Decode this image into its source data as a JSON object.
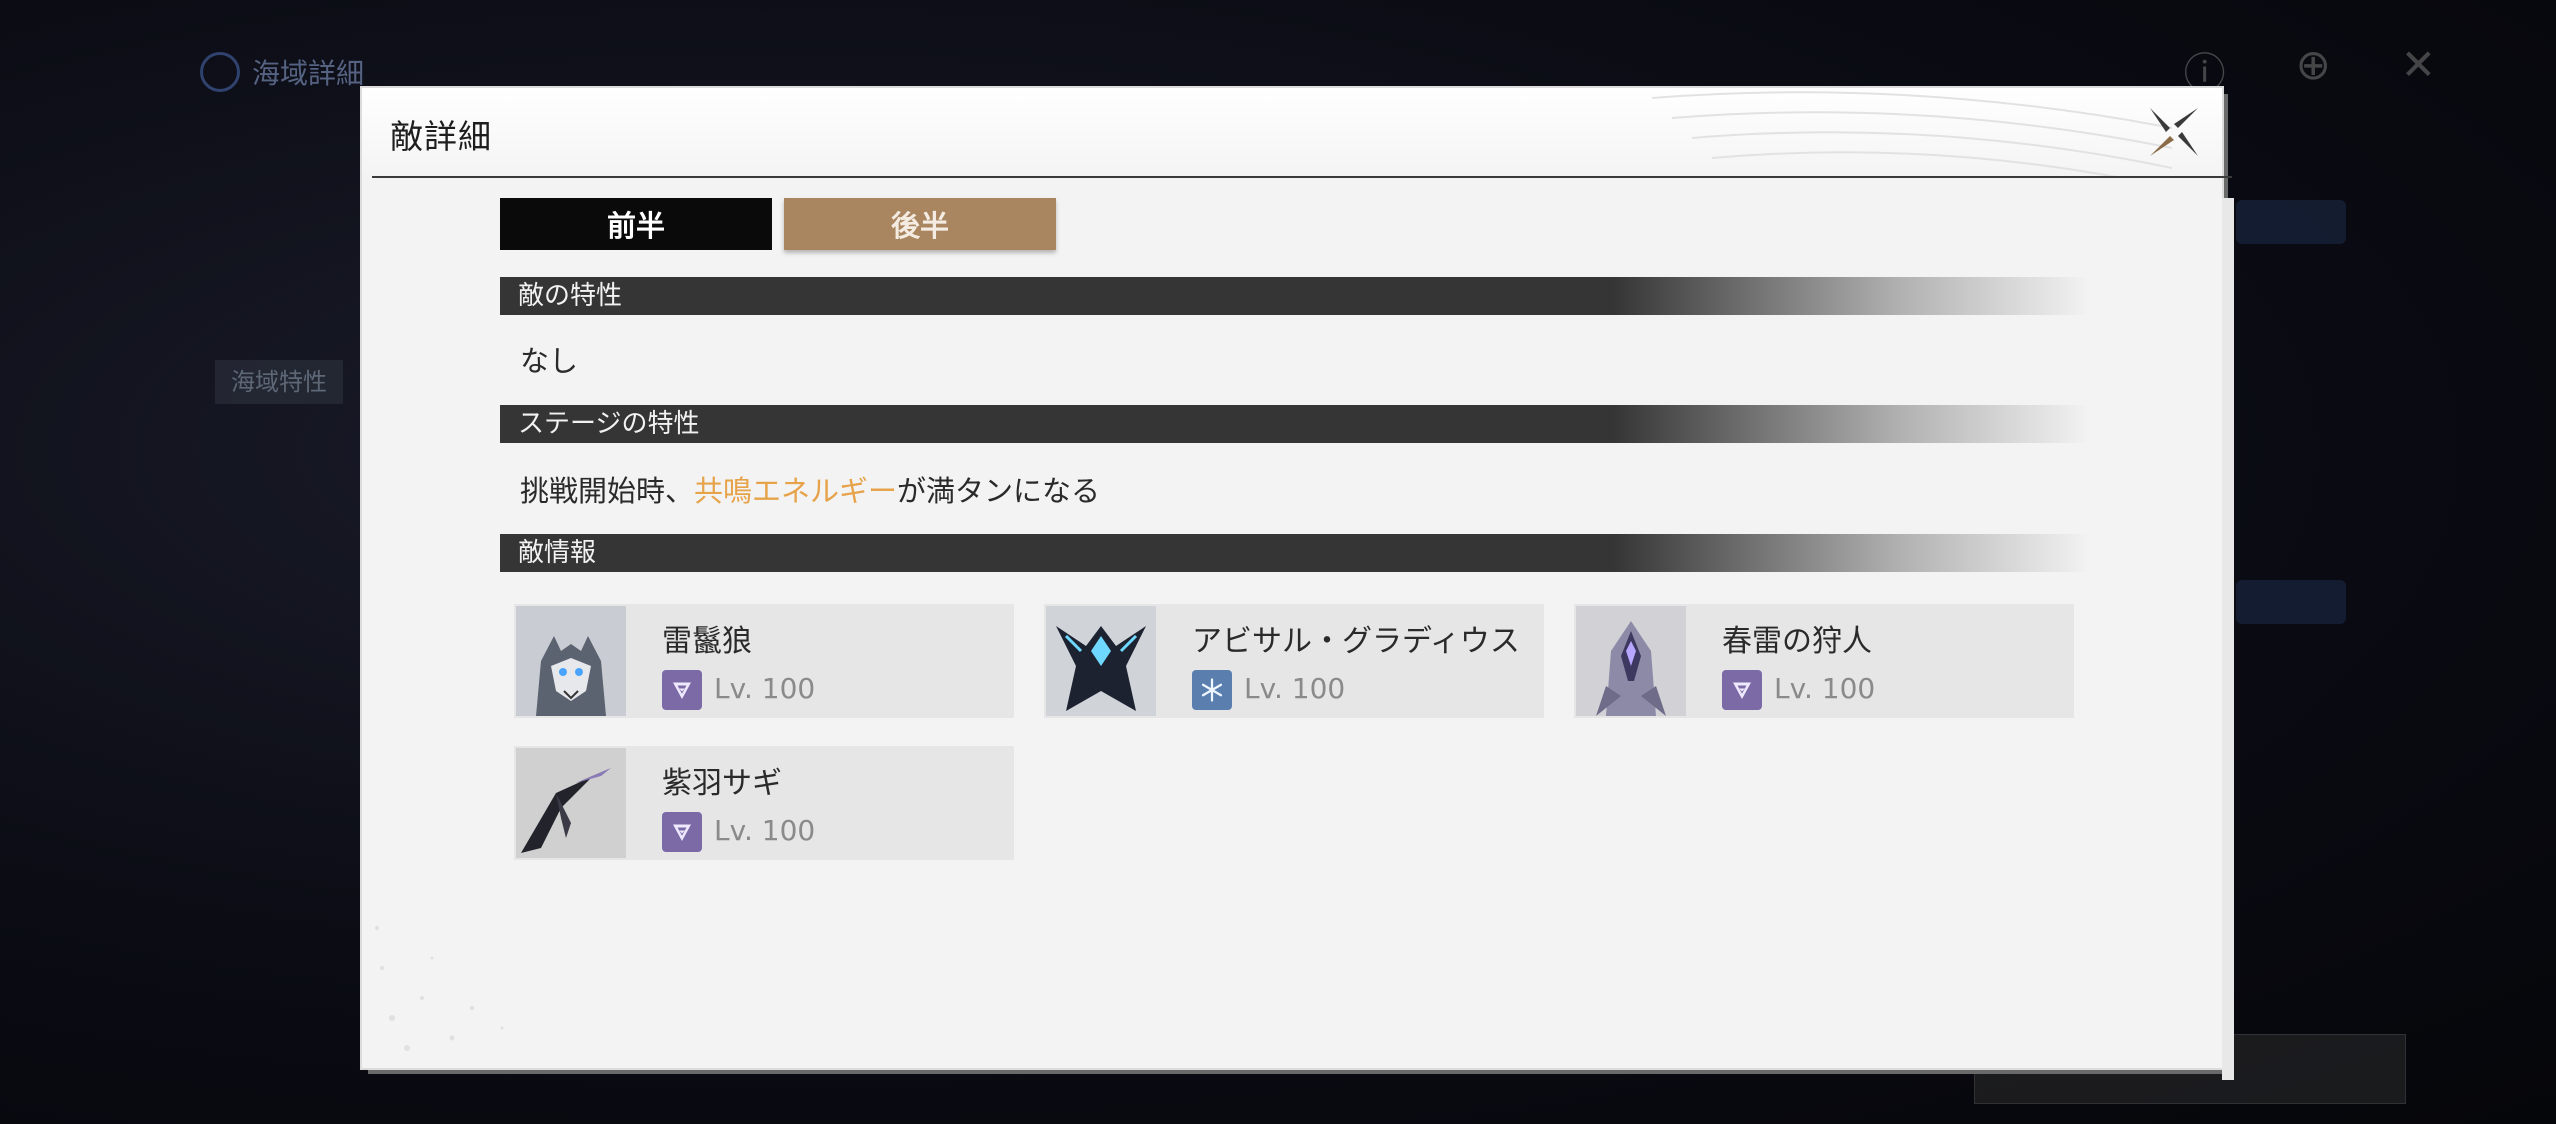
{
  "background": {
    "title": "海域詳細",
    "left_tag": "海域特性"
  },
  "modal": {
    "title": "敵詳細",
    "tabs": [
      {
        "label": "前半",
        "active": true
      },
      {
        "label": "後半",
        "active": false
      }
    ],
    "sections": {
      "enemy_traits": {
        "title": "敵の特性",
        "text": "なし"
      },
      "stage_traits": {
        "title": "ステージの特性",
        "text_before": "挑戦開始時、",
        "text_highlight": "共鳴エネルギー",
        "text_after": "が満タンになる"
      },
      "enemy_info": {
        "title": "敵情報"
      }
    },
    "enemies": [
      {
        "name": "雷鬣狼",
        "element": "electro-icon",
        "level": "Lv. 100"
      },
      {
        "name": "アビサル・グラディウス",
        "element": "glacio-icon",
        "level": "Lv. 100"
      },
      {
        "name": "春雷の狩人",
        "element": "electro-icon",
        "level": "Lv. 100"
      },
      {
        "name": "紫羽サギ",
        "element": "electro-icon",
        "level": "Lv. 100"
      }
    ]
  },
  "colors": {
    "active_tab": "#0a0a0a",
    "inactive_tab": "#a98660",
    "highlight": "#e6a34a",
    "electro": "#7b6aa6",
    "glacio": "#5a7fae"
  }
}
